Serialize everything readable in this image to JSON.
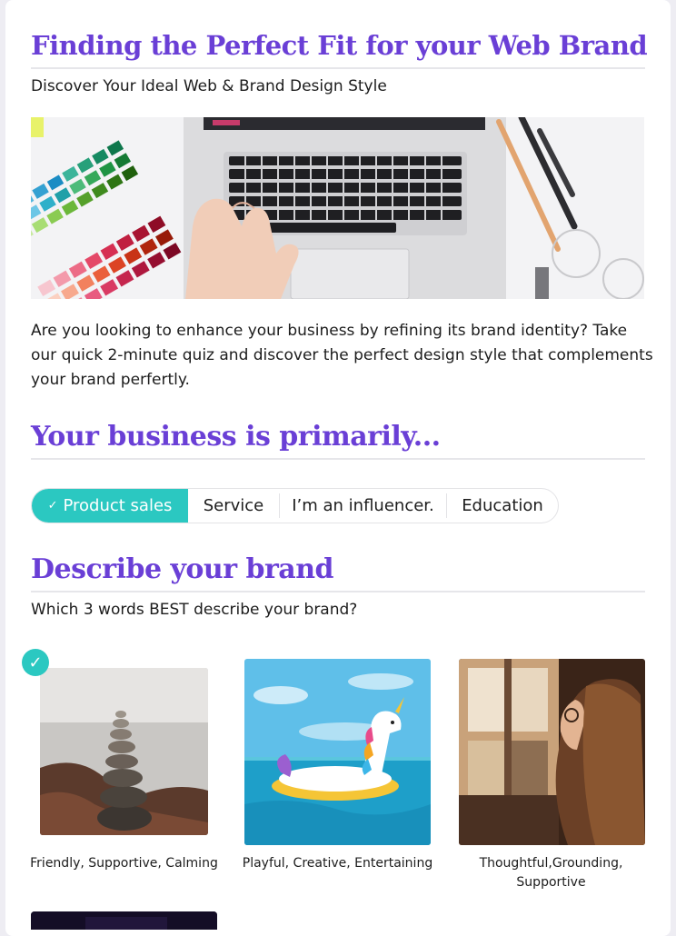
{
  "header": {
    "title": "Finding the Perfect Fit for your Web Brand",
    "subtitle": "Discover Your Ideal Web & Brand Design Style"
  },
  "hero": {
    "alt_icon": "laptop-color-swatches-photo"
  },
  "intro": {
    "line1": "Are you looking to enhance your business by refining its brand identity? Take",
    "line2": "our quick 2-minute quiz and discover the perfect design style that complements",
    "line3": "your brand perfertly."
  },
  "business": {
    "heading": "Your business is primarily...",
    "options": [
      {
        "label": "Product sales",
        "selected": true
      },
      {
        "label": "Service",
        "selected": false
      },
      {
        "label": "I’m an influencer.",
        "selected": false
      },
      {
        "label": "Education",
        "selected": false
      }
    ],
    "check_glyph": "✓"
  },
  "brand": {
    "heading": "Describe your brand",
    "question": "Which 3 words BEST describe your brand?",
    "check_glyph": "✓",
    "options": [
      {
        "caption": "Friendly, Supportive, Calming",
        "selected": true,
        "image": "stacked-stones-photo"
      },
      {
        "caption": "Playful, Creative, Entertaining",
        "selected": false,
        "image": "unicorn-float-photo"
      },
      {
        "caption_line1": "Thoughtful,Grounding,",
        "caption_line2": "Supportive",
        "selected": false,
        "image": "woman-window-photo"
      }
    ]
  },
  "colors": {
    "accent": "#6a3fd6",
    "selected": "#2bc8c1",
    "text": "#1c1c1c",
    "rule": "#e6e6ea"
  }
}
